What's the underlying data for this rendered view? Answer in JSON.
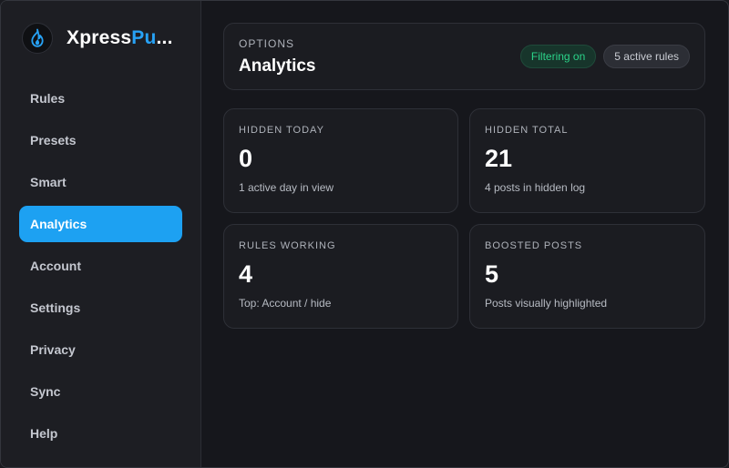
{
  "brand": {
    "name_part1": "Xpress",
    "name_part2": "Pu",
    "name_ellipsis": "...",
    "logo_icon": "flame-icon",
    "accent_color": "#1da1f2"
  },
  "sidebar": {
    "items": [
      {
        "label": "Rules",
        "active": false
      },
      {
        "label": "Presets",
        "active": false
      },
      {
        "label": "Smart",
        "active": false
      },
      {
        "label": "Analytics",
        "active": true
      },
      {
        "label": "Account",
        "active": false
      },
      {
        "label": "Settings",
        "active": false
      },
      {
        "label": "Privacy",
        "active": false
      },
      {
        "label": "Sync",
        "active": false
      },
      {
        "label": "Help",
        "active": false
      }
    ]
  },
  "header": {
    "eyebrow": "OPTIONS",
    "title": "Analytics",
    "badges": {
      "filtering": "Filtering on",
      "rules": "5 active rules"
    }
  },
  "stats": [
    {
      "label": "HIDDEN TODAY",
      "value": "0",
      "sub": "1 active day in view"
    },
    {
      "label": "HIDDEN TOTAL",
      "value": "21",
      "sub": "4 posts in hidden log"
    },
    {
      "label": "RULES WORKING",
      "value": "4",
      "sub": "Top: Account / hide"
    },
    {
      "label": "BOOSTED POSTS",
      "value": "5",
      "sub": "Posts visually highlighted"
    }
  ]
}
